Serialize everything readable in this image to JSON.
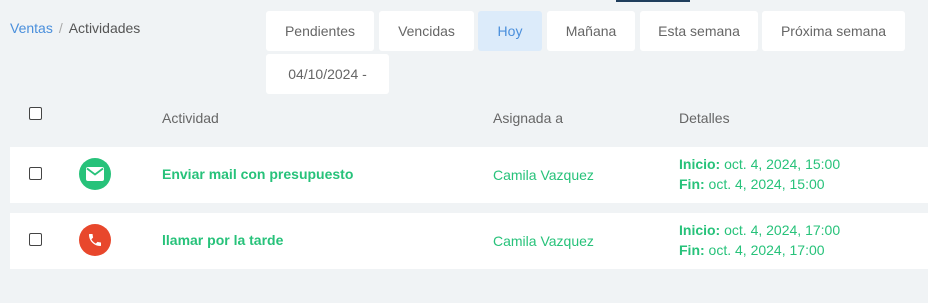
{
  "breadcrumb": {
    "root": "Ventas",
    "separator": "/",
    "current": "Actividades"
  },
  "filters": {
    "pendientes": "Pendientes",
    "vencidas": "Vencidas",
    "hoy": "Hoy",
    "manana": "Mañana",
    "esta_semana": "Esta semana",
    "proxima_semana": "Próxima semana",
    "fecha": "04/10/2024 -"
  },
  "table": {
    "headers": {
      "actividad": "Actividad",
      "asignada": "Asignada a",
      "detalles": "Detalles"
    },
    "rows": [
      {
        "icon": "mail-icon",
        "icon_color": "#27c27a",
        "title": "Enviar mail con presupuesto",
        "assigned": "Camila Vazquez",
        "inicio_label": "Inicio:",
        "inicio": "oct. 4, 2024, 15:00",
        "fin_label": "Fin:",
        "fin": "oct. 4, 2024, 15:00"
      },
      {
        "icon": "phone-icon",
        "icon_color": "#e8472c",
        "title": "llamar por la tarde",
        "assigned": "Camila Vazquez",
        "inicio_label": "Inicio:",
        "inicio": "oct. 4, 2024, 17:00",
        "fin_label": "Fin:",
        "fin": "oct. 4, 2024, 17:00"
      }
    ]
  }
}
